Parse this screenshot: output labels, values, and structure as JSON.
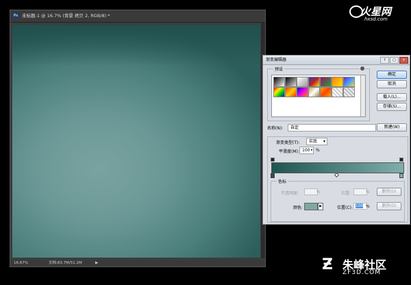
{
  "document": {
    "title": "未标题-1 @ 16.7% (背景 拷贝 2, RGB/8) *",
    "ps_badge": "Ps",
    "zoom": "16.67%",
    "doc_info": "文档:83.7M/51.2M",
    "status_arrow": "▶"
  },
  "dialog": {
    "title": "渐变编辑器",
    "presets_label": "预设",
    "buttons": {
      "ok": "确定",
      "cancel": "取消",
      "load": "载入(L)...",
      "save": "存储(S)...",
      "new": "新建(W)"
    },
    "name_label": "名称(N):",
    "name_value": "自定",
    "gradient_type_label": "渐变类型(T):",
    "gradient_type_value": "实底",
    "smoothness_label": "平滑度(M):",
    "smoothness_value": "100",
    "percent": "%",
    "stops_label": "色标",
    "opacity_label": "不透明度:",
    "location_label": "位置:",
    "delete_button": "删除(D)",
    "color_label": "颜色:",
    "location_c_label": "位置(C):",
    "location_c_value": "100",
    "gradient_colors": {
      "start": "#1f5451",
      "end": "#80afab"
    },
    "selected_color": "#7fa7a4"
  },
  "window_buttons": [
    "?",
    "▢",
    "✕"
  ],
  "watermarks": {
    "top_right_main": "火星网",
    "top_right_sub": "hxsd.com",
    "bottom_right_main": "朱峰社区",
    "bottom_right_sub": "ZF3D.COM"
  }
}
